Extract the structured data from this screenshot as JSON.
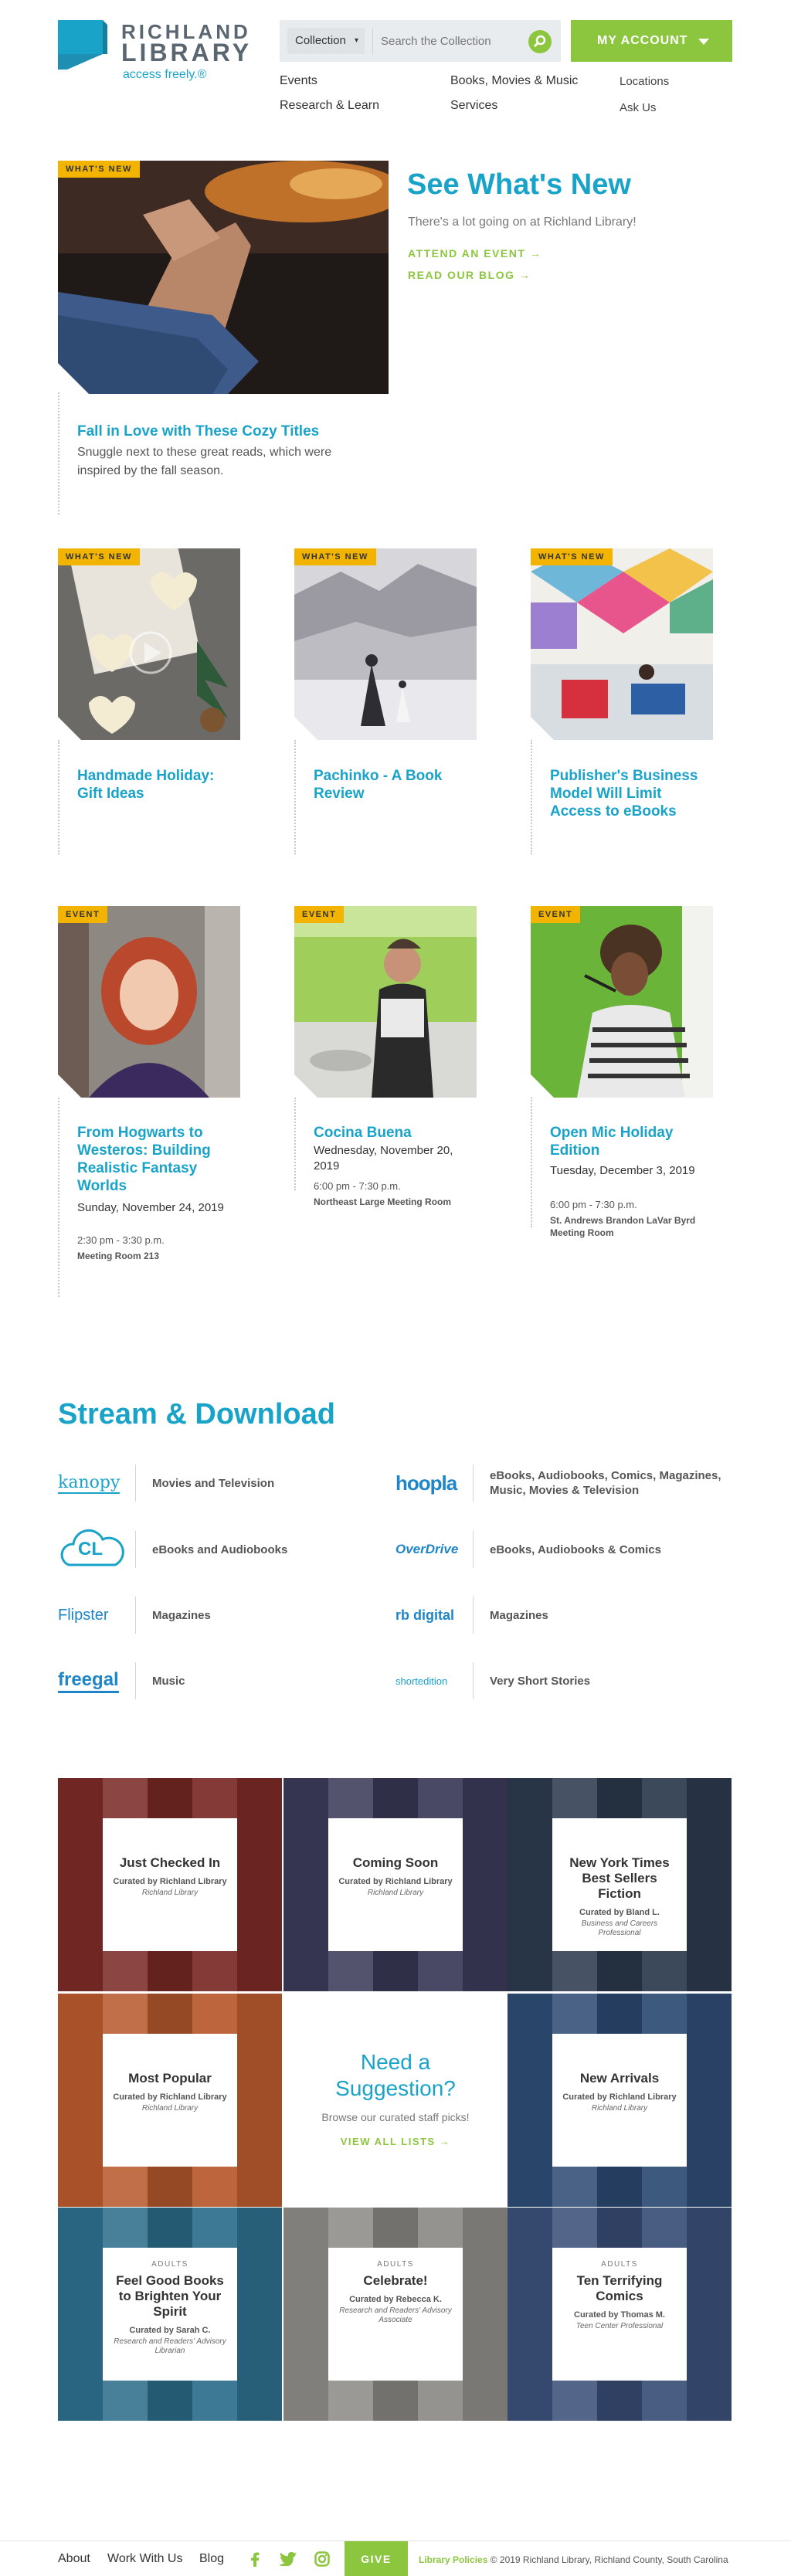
{
  "header": {
    "logo_line1": "RICHLAND",
    "logo_line2": "LIBRARY",
    "logo_tagline": "access freely.®",
    "search_category": "Collection",
    "search_placeholder": "Search the Collection",
    "my_account": "MY ACCOUNT",
    "nav": [
      "Events",
      "Books, Movies & Music",
      "Research & Learn",
      "Services"
    ],
    "utility": [
      "Locations",
      "Ask Us"
    ]
  },
  "feature": {
    "badge": "WHAT'S NEW",
    "title": "Fall in Love with These Cozy Titles",
    "desc": "Snuggle next to these great reads, which were inspired by the fall season."
  },
  "see_whats_new": {
    "title": "See What's New",
    "subtitle": "There's a lot going on at Richland Library!",
    "link1": "ATTEND AN EVENT →",
    "link2": "READ OUR BLOG →"
  },
  "news_cards": [
    {
      "badge": "WHAT'S NEW",
      "title": "Handmade Holiday: Gift Ideas"
    },
    {
      "badge": "WHAT'S NEW",
      "title": "Pachinko - A Book Review"
    },
    {
      "badge": "WHAT'S NEW",
      "title": "Publisher's Business Model Will Limit Access to eBooks"
    }
  ],
  "event_cards": [
    {
      "badge": "EVENT",
      "title": "From Hogwarts to Westeros: Building Realistic Fantasy Worlds",
      "date": "Sunday, November 24, 2019",
      "time": "2:30 pm - 3:30 p.m.",
      "room": "Meeting Room 213"
    },
    {
      "badge": "EVENT",
      "title": "Cocina Buena",
      "date": "Wednesday, November 20, 2019",
      "time": "6:00 pm - 7:30 p.m.",
      "room": "Northeast Large Meeting Room"
    },
    {
      "badge": "EVENT",
      "title": "Open Mic Holiday Edition",
      "date": "Tuesday, December 3, 2019",
      "time": "6:00 pm - 7:30 p.m.",
      "room": "St. Andrews Brandon LaVar Byrd Meeting Room"
    }
  ],
  "stream": {
    "title": "Stream & Download",
    "items": [
      {
        "logo": "kanopy",
        "label": "Movies and Television"
      },
      {
        "logo": "hoopla",
        "label": "eBooks, Audiobooks, Comics, Magazines, Music, Movies & Television"
      },
      {
        "logo": "CL",
        "label": "eBooks and Audiobooks"
      },
      {
        "logo": "OverDrive",
        "label": "eBooks, Audiobooks & Comics"
      },
      {
        "logo": "Flipster",
        "label": "Magazines"
      },
      {
        "logo": "rb digital",
        "label": "Magazines"
      },
      {
        "logo": "freegal",
        "label": "Music"
      },
      {
        "logo": "shortedition",
        "label": "Very Short Stories"
      }
    ]
  },
  "lists": [
    {
      "small": "",
      "name": "Just Checked In",
      "curated": "Curated by Richland Library",
      "role": "Richland Library",
      "bg": "#7a2a26"
    },
    {
      "small": "",
      "name": "Coming Soon",
      "curated": "Curated by Richland Library",
      "role": "Richland Library",
      "bg": "#3b3a58"
    },
    {
      "small": "",
      "name": "New York Times Best Sellers Fiction",
      "curated": "Curated by Bland L.",
      "role": "Business and Careers Professional",
      "bg": "#2c3a4e"
    },
    {
      "small": "",
      "name": "Most Popular",
      "curated": "Curated by Richland Library",
      "role": "Richland Library",
      "bg": "#b85a2e"
    },
    {
      "small": "",
      "name": "New Arrivals",
      "curated": "Curated by Richland Library",
      "role": "Richland Library",
      "bg": "#2e4b73"
    },
    {
      "small": "ADULTS",
      "name": "Feel Good Books to Brighten Your Spirit",
      "curated": "Curated by Sarah C.",
      "role": "Research and Readers' Advisory Librarian",
      "bg": "#2d6e8c"
    },
    {
      "small": "ADULTS",
      "name": "Celebrate!",
      "curated": "Curated by Rebecca K.",
      "role": "Research and Readers' Advisory Associate",
      "bg": "#8c8a86"
    },
    {
      "small": "ADULTS",
      "name": "Ten Terrifying Comics",
      "curated": "Curated by Thomas M.",
      "role": "Teen Center Professional",
      "bg": "#3a4f78"
    }
  ],
  "suggestion": {
    "title": "Need a Suggestion?",
    "sub": "Browse our curated staff picks!",
    "link": "VIEW ALL LISTS →"
  },
  "footer": {
    "links": [
      "About",
      "Work With Us",
      "Blog"
    ],
    "give": "GIVE",
    "policies": "Library Policies",
    "copyright": "© 2019 Richland Library, Richland County, South Carolina"
  },
  "colors": {
    "brand_blue": "#1aa3c9",
    "brand_green": "#8cc63f",
    "badge_yellow": "#f2b400"
  }
}
